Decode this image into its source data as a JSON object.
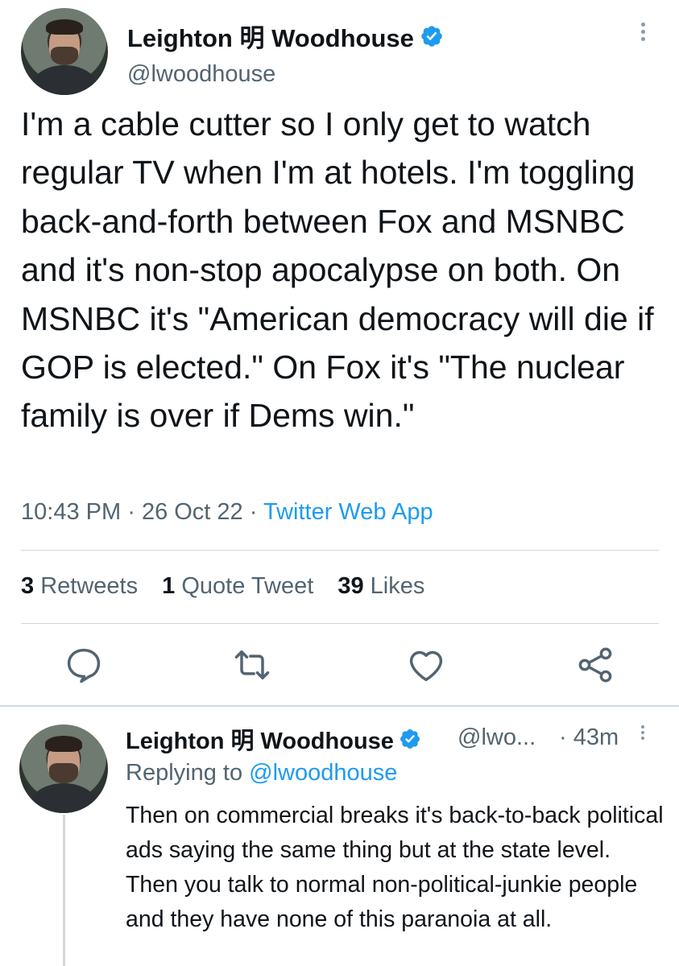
{
  "tweet": {
    "author_name": "Leighton 明 Woodhouse",
    "author_handle": "@lwoodhouse",
    "text": "I'm a cable cutter so I only get to watch regular TV when I'm at hotels. I'm toggling back-and-forth between Fox and MSNBC and it's non-stop apocalypse on both. On MSNBC it's \"American democracy will die if GOP is elected.\" On Fox it's \"The nuclear family is over if Dems win.\"",
    "time": "10:43 PM",
    "dot": "·",
    "date": "26 Oct 22",
    "app": "Twitter Web App",
    "retweets_count": "3",
    "retweets_label": "Retweets",
    "quotes_count": "1",
    "quotes_label": "Quote Tweet",
    "likes_count": "39",
    "likes_label": "Likes"
  },
  "reply": {
    "author_name": "Leighton 明 Woodhouse",
    "author_handle": "@lwo...",
    "time": "· 43m",
    "replying_label": "Replying to",
    "replying_to": "@lwoodhouse",
    "text": "Then on commercial breaks it's back-to-back political ads saying the same thing but at the state level. Then you talk to normal non-political-junkie people and they have none of this paranoia at all."
  },
  "colors": {
    "accent": "#1d9bf0",
    "text": "#0f1419",
    "secondary": "#536471",
    "divider": "#cfd9de"
  },
  "icons": [
    "verified-badge-icon",
    "more-options-icon",
    "reply-icon",
    "retweet-icon",
    "like-icon",
    "share-icon"
  ]
}
